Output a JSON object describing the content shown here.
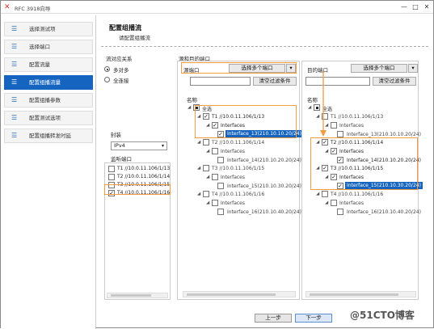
{
  "window": {
    "title": "RFC 3918向导",
    "controls": [
      "—",
      "□",
      "✕"
    ]
  },
  "sidebar": {
    "items": [
      {
        "label": "选择测试项",
        "active": false
      },
      {
        "label": "选择端口",
        "active": false
      },
      {
        "label": "配置流量",
        "active": false
      },
      {
        "label": "配置组播流量",
        "active": true
      },
      {
        "label": "配置组播参数",
        "active": false
      },
      {
        "label": "配置测试选项",
        "active": false
      },
      {
        "label": "配置组播转发时延",
        "active": false
      }
    ]
  },
  "header": {
    "title": "配置组播流",
    "subtitle": "请配置组播流"
  },
  "left_panel": {
    "mode_label": "流对应关系",
    "mode_options": [
      {
        "label": "多对多",
        "selected": true
      },
      {
        "label": "全连接",
        "selected": false
      }
    ],
    "protocol_label": "封装",
    "protocol_value": "IPv4",
    "monitor_label": "监听端口",
    "ports": [
      {
        "label": "T1 //10.0.11.106/1/13",
        "checked": false
      },
      {
        "label": "T2 //10.0.11.106/1/14",
        "checked": false
      },
      {
        "label": "T3 //10.0.11.106/1/15",
        "checked": false
      },
      {
        "label": "T4 //10.0.11.106/1/16",
        "checked": true
      }
    ]
  },
  "middle_panel": {
    "title": "源和目的端口",
    "src_label": "源端口",
    "select_btn": "选择多个端口",
    "clear_btn": "清空过滤条件",
    "name_col": "名称",
    "root": "全选",
    "tree": [
      {
        "port": "T1 //10.0.11.106/1/13",
        "ifaces": "Interfaces",
        "iface": "Interface_13(210.10.10.20/24)"
      },
      {
        "port": "T2 //10.0.11.106/1/14",
        "ifaces": "Interfaces",
        "iface": "Interface_14(210.10.20.20/24)"
      },
      {
        "port": "T3 //10.0.11.106/1/15",
        "ifaces": "Interfaces",
        "iface": "Interface_15(210.10.30.20/24)"
      },
      {
        "port": "T4 //10.0.11.106/1/16",
        "ifaces": "Interfaces",
        "iface": "Interface_16(210.10.40.20/24)"
      }
    ]
  },
  "right_panel": {
    "dst_label": "目的端口",
    "select_btn": "选择多个端口",
    "clear_btn": "清空过滤条件",
    "name_col": "名称",
    "root": "全选",
    "tree": [
      {
        "port": "T1 //10.0.11.106/1/13",
        "ifaces": "Interfaces",
        "iface": "Interface_13(210.10.10.20/24)"
      },
      {
        "port": "T2 //10.0.11.106/1/14",
        "ifaces": "Interfaces",
        "iface": "Interface_14(210.10.20.20/24)"
      },
      {
        "port": "T3 //10.0.11.106/1/15",
        "ifaces": "Interfaces",
        "iface": "Interface_15(210.10.30.20/24)"
      },
      {
        "port": "T4 //10.0.11.106/1/16",
        "ifaces": "Interfaces",
        "iface": "Interface_16(210.10.40.20/24)"
      }
    ]
  },
  "footer": {
    "prev": "上一步",
    "next": "下一步",
    "watermark": "@51CTO博客"
  },
  "colors": {
    "accent": "#1565c0",
    "highlight_box": "#f39c43"
  }
}
